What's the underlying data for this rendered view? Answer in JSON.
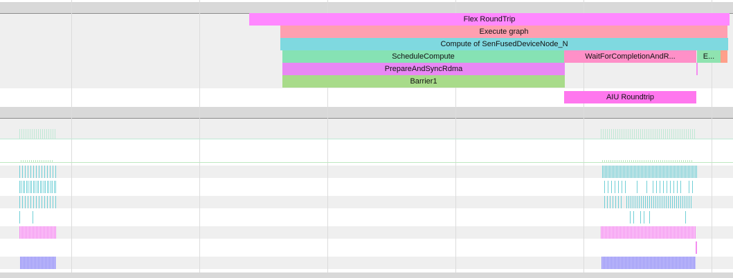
{
  "slices": {
    "flex_roundtrip": "Flex RoundTrip",
    "execute_graph": "Execute graph",
    "compute_node": "Compute of SenFusedDeviceNode_N",
    "schedule_compute": "ScheduleCompute",
    "wait_for_completion": "WaitForCompletionAndR...",
    "e_slice": "E...",
    "prepare_sync": "PrepareAndSyncRdma",
    "barrier": "Barrier1",
    "aiu_roundtrip": "AIU Roundtrip"
  },
  "colors": {
    "flex_roundtrip": "#ff88ff",
    "execute_graph": "#ff9fb0",
    "compute_node": "#7fd9e0",
    "schedule_compute": "#86e2b4",
    "wait_for_completion": "#ff90c8",
    "e_slice": "#8fe3b0",
    "prepare_sync": "#e888f4",
    "barrier": "#a8db8a",
    "aiu_roundtrip": "#ff77ee",
    "teal_ticks": "#6fcfd6",
    "green_ticks": "#8fdcb0",
    "magenta_ticks": "#f48cf0",
    "purple_ticks": "#a8a4f8"
  }
}
